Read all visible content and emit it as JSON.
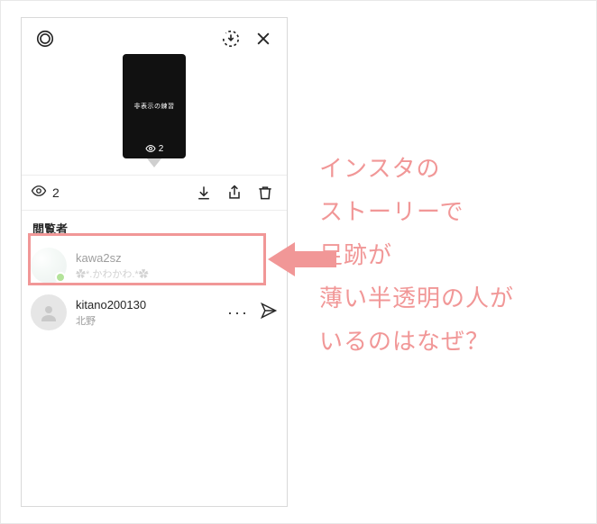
{
  "topbar": {
    "settings_icon": "gear",
    "save_icon": "download-circle",
    "close_icon": "close"
  },
  "preview": {
    "caption": "非表示の練習",
    "view_count": "2"
  },
  "viewers_bar": {
    "count": "2",
    "download_icon": "download",
    "share_icon": "share",
    "delete_icon": "trash"
  },
  "section_title": "閲覧者",
  "viewers": [
    {
      "username": "kawa2sz",
      "display_name": "✿*.かわかわ.*✿",
      "online": true,
      "faded": true
    },
    {
      "username": "kitano200130",
      "display_name": "北野",
      "online": false,
      "faded": false
    }
  ],
  "annotation": {
    "highlight_color": "#f19797",
    "arrow_color": "#f19797",
    "lines": [
      "インスタの",
      "ストーリーで",
      "足跡が",
      "薄い半透明の人が",
      "いるのはなぜ？"
    ]
  }
}
